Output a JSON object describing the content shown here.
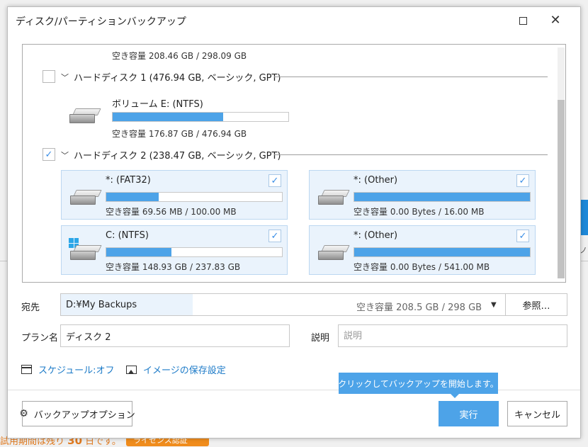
{
  "dialog": {
    "title": "ディスク/パーティションバックアップ",
    "maximize_icon": "maximize-icon",
    "close_glyph": "✕"
  },
  "list": {
    "prev_free": "空き容量 208.46 GB / 298.09 GB",
    "disk1": {
      "label": "ハードディスク 1 (476.94 GB, ベーシック, GPT)",
      "checked": false,
      "partitions": [
        {
          "name": "ボリューム E: (NTFS)",
          "free": "空き容量 176.87 GB / 476.94 GB",
          "used_fraction": 0.63
        }
      ]
    },
    "disk2": {
      "label": "ハードディスク 2 (238.47 GB, ベーシック, GPT)",
      "checked": true,
      "partitions": [
        {
          "name": "*: (FAT32)",
          "free": "空き容量 69.56 MB / 100.00 MB",
          "used_fraction": 0.3,
          "checked": true,
          "icon": "drive-icon"
        },
        {
          "name": "*: (Other)",
          "free": "空き容量 0.00 Bytes / 16.00 MB",
          "used_fraction": 1.0,
          "checked": true,
          "icon": "drive-icon"
        },
        {
          "name": "C: (NTFS)",
          "free": "空き容量 148.93 GB / 237.83 GB",
          "used_fraction": 0.37,
          "checked": true,
          "icon": "windows-drive-icon"
        },
        {
          "name": "*: (Other)",
          "free": "空き容量 0.00 Bytes / 541.00 MB",
          "used_fraction": 1.0,
          "checked": true,
          "icon": "drive-icon"
        }
      ]
    }
  },
  "form": {
    "dest_label": "宛先",
    "dest_path": "D:¥My Backups",
    "dest_free": "空き容量 208.5 GB / 298 GB",
    "browse_label": "参照…",
    "plan_label": "プラン名",
    "plan_value": "ディスク 2",
    "desc_label": "説明",
    "desc_placeholder": "説明"
  },
  "links": {
    "schedule": "スケジュール:オフ",
    "image_settings": "イメージの保存設定"
  },
  "tooltip": "クリックしてバックアップを開始します。",
  "buttons": {
    "options": "バックアップオプション",
    "run": "実行",
    "cancel": "キャンセル"
  },
  "background": {
    "trial_prefix": "試用期間は残り",
    "trial_days": "30",
    "trial_suffix": "日です。",
    "license": "ライセンス認証"
  },
  "colors": {
    "accent": "#4da3e8",
    "link": "#1d7bc8",
    "card_bg": "#eaf3fc"
  }
}
